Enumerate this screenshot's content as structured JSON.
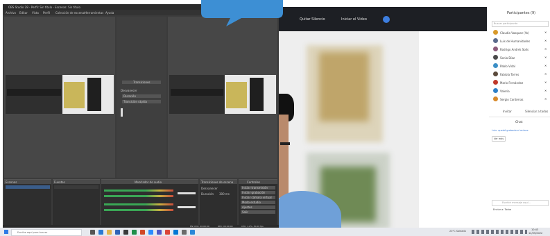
{
  "obs": {
    "title": "OBS Studio 28 - Perfil: Sin título - Escenas: Sin título",
    "menu": [
      "Archivo",
      "Editar",
      "Vista",
      "Perfil",
      "Colección de escenas",
      "Herramientas",
      "Ayuda"
    ],
    "transition": {
      "label": "Transiciones",
      "type": "Desvanecer",
      "duration_label": "Duración",
      "duration_value": "300 ms",
      "quick": "Transición rápida"
    },
    "docks": {
      "scenes": "Escenas",
      "sources": "Fuentes",
      "mixer": "Mezclador de audio",
      "transitions": "Transiciones de escena",
      "controls": "Controles"
    },
    "controls": [
      "Iniciar transmisión",
      "Iniciar grabación",
      "Iniciar cámara virtual",
      "Modo estudio",
      "Ajustes",
      "Salir"
    ],
    "status": {
      "live": "EN VIVO: 00:00:00",
      "rec": "REC: 00:00:00",
      "cpu": "CPU: 1.2%, 30.00 fps"
    }
  },
  "call": {
    "buttons": [
      "Quitar Silencio",
      "Iniciar el Video"
    ]
  },
  "panel": {
    "title": "Participantes (9)",
    "search_placeholder": "Buscar participante",
    "participants": [
      {
        "name": "Claudia Vasquez (Yo)",
        "color": "#d89a2b"
      },
      {
        "name": "Luis de Humanidades",
        "color": "#5b6b8c"
      },
      {
        "name": "Rodrigo Andrés Solís",
        "color": "#8c5b7a"
      },
      {
        "name": "Sonia Díaz",
        "color": "#4a4a4a"
      },
      {
        "name": "Pablo Vidal",
        "color": "#3c8fc6"
      },
      {
        "name": "Fabiola Torres",
        "color": "#5b4a3c"
      },
      {
        "name": "Mario Fernández",
        "color": "#c0392b"
      },
      {
        "name": "Valeria",
        "color": "#2f80c8"
      },
      {
        "name": "Sergio Contreras",
        "color": "#d88a2b"
      }
    ],
    "actions": [
      "Invitar",
      "Silenciar a todos"
    ],
    "chat": {
      "title": "Chat",
      "message": "Luis: quedó grabado el enlace",
      "button": "Ver más",
      "input_placeholder": "Escribir mensaje aquí...",
      "to_label": "Enviar a: Todos"
    }
  },
  "taskbar": {
    "search_placeholder": "Escribe aquí para buscar",
    "weather": "20°C Soleado",
    "time": "10:43",
    "date": "12/05/2022"
  }
}
